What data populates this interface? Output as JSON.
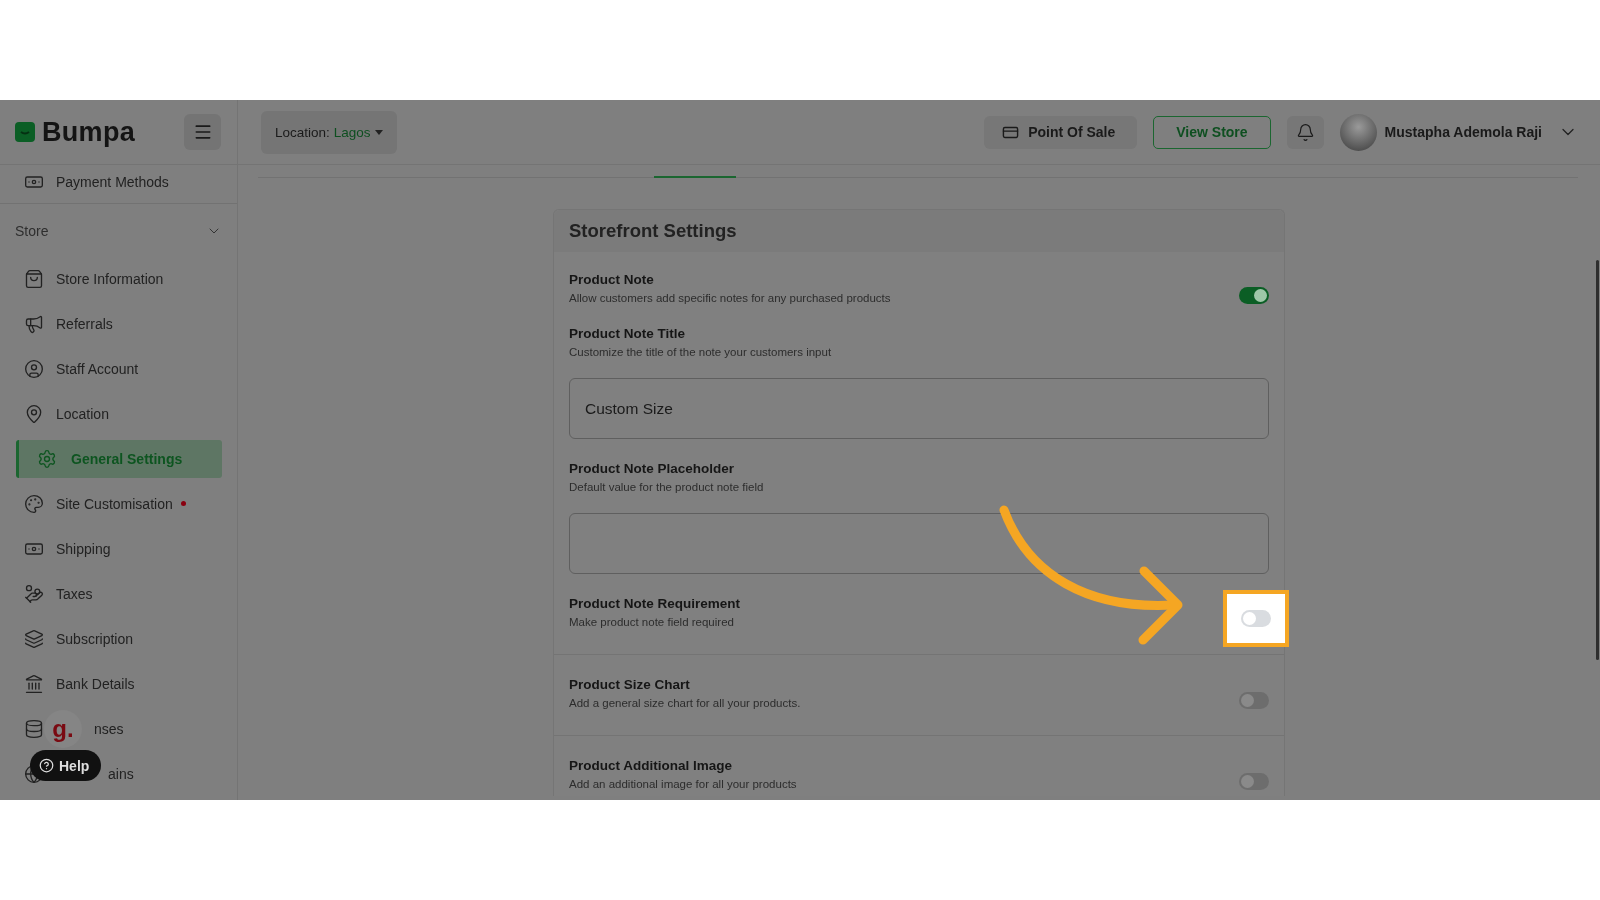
{
  "header": {
    "logo": "Bumpa",
    "location_label": "Location:",
    "location_value": "Lagos",
    "pos_button": "Point Of Sale",
    "view_store_button": "View Store",
    "user_name": "Mustapha Ademola Raji"
  },
  "sidebar": {
    "top_item": {
      "label": "Payment Methods"
    },
    "section": "Store",
    "items": [
      {
        "label": "Store Information",
        "selected": false,
        "notification": false
      },
      {
        "label": "Referrals",
        "selected": false,
        "notification": false
      },
      {
        "label": "Staff Account",
        "selected": false,
        "notification": false
      },
      {
        "label": "Location",
        "selected": false,
        "notification": false
      },
      {
        "label": "General Settings",
        "selected": true,
        "notification": false
      },
      {
        "label": "Site Customisation",
        "selected": false,
        "notification": true
      },
      {
        "label": "Shipping",
        "selected": false,
        "notification": false
      },
      {
        "label": "Taxes",
        "selected": false,
        "notification": false
      },
      {
        "label": "Subscription",
        "selected": false,
        "notification": false
      },
      {
        "label": "Bank Details",
        "selected": false,
        "notification": false
      },
      {
        "label": "nses",
        "selected": false,
        "notification": false
      },
      {
        "label": "ains",
        "selected": false,
        "notification": false
      }
    ]
  },
  "chat_widget": {
    "logo": "g.",
    "help_button": "Help"
  },
  "settings": {
    "title": "Storefront Settings",
    "rows": [
      {
        "kind": "toggle",
        "title": "Product Note",
        "description": "Allow customers add specific notes for any purchased products",
        "on": true,
        "highlighted": false
      },
      {
        "kind": "field",
        "title": "Product Note Title",
        "description": "Customize the title of the note your customers input",
        "value": "Custom Size"
      },
      {
        "kind": "field",
        "title": "Product Note Placeholder",
        "description": "Default value for the product note field"
      },
      {
        "kind": "toggle",
        "title": "Product Note Requirement",
        "description": "Make product note field required",
        "on": false,
        "highlighted": true
      },
      {
        "kind": "toggle",
        "title": "Product Size Chart",
        "description": "Add a general size chart for all your products.",
        "on": false,
        "highlighted": false
      },
      {
        "kind": "toggle",
        "title": "Product Additional Image",
        "description": "Add an additional image for all your products",
        "on": false,
        "highlighted": false
      }
    ]
  }
}
